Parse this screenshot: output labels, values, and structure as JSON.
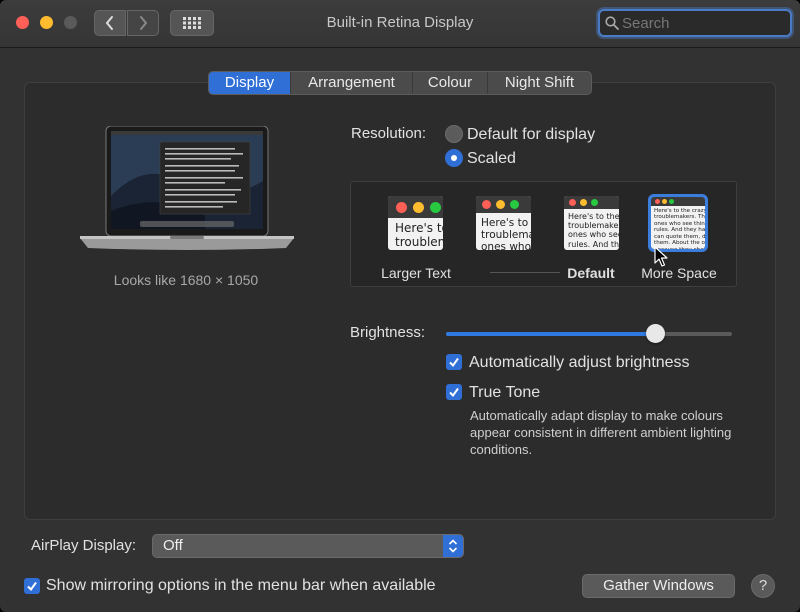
{
  "window": {
    "title": "Built-in Retina Display",
    "search": {
      "placeholder": "Search",
      "value": ""
    },
    "icons": [
      "close-light",
      "minimize-light",
      "zoom-light",
      "chevron-left-icon",
      "chevron-right-icon",
      "grid-icon",
      "search-icon"
    ]
  },
  "tabs": [
    {
      "label": "Display",
      "active": true
    },
    {
      "label": "Arrangement",
      "active": false
    },
    {
      "label": "Colour",
      "active": false
    },
    {
      "label": "Night Shift",
      "active": false
    }
  ],
  "display": {
    "looks_like": "Looks like 1680 × 1050",
    "resolution": {
      "label": "Resolution:",
      "options": [
        "Default for display",
        "Scaled"
      ],
      "selected": "Scaled"
    },
    "scaling": {
      "options": [
        {
          "label": "Larger Text",
          "sample": "Here's to\ntroublem",
          "bold": false
        },
        {
          "label": "",
          "sample": "Here's to t\ntroublema\nones who",
          "bold": false
        },
        {
          "label": "Default",
          "sample": "Here's to the cr\ntroublemakers.\nones who see t\nrules. And they",
          "bold": true
        },
        {
          "label": "More Space",
          "sample": "Here's to the crazy ones\ntroublemakers. The rou\nones who see things dif\nrules. And they have no\ncan quote them, disagre\nthem. About the only th\nbecause they change th",
          "bold": false
        }
      ],
      "selected_index": 3
    },
    "brightness": {
      "label": "Brightness:",
      "value": 0.73,
      "auto_label": "Automatically adjust brightness",
      "auto_checked": true
    },
    "true_tone": {
      "label": "True Tone",
      "checked": true,
      "description": "Automatically adapt display to make colours appear consistent in different ambient lighting conditions."
    }
  },
  "footer": {
    "airplay_label": "AirPlay Display:",
    "airplay_value": "Off",
    "mirroring_label": "Show mirroring options in the menu bar when available",
    "mirroring_checked": true,
    "gather_label": "Gather Windows",
    "help_label": "?"
  },
  "colors": {
    "accent": "#2f6fd6",
    "window_bg": "#323232",
    "panel_bg": "#2c2c2c"
  }
}
